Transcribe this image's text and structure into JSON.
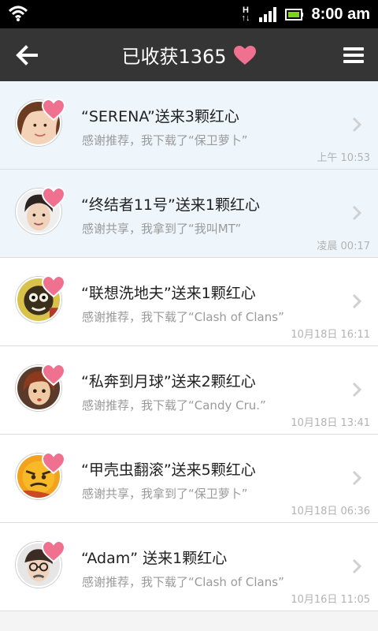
{
  "status_bar": {
    "time": "8:00 am",
    "network": "H"
  },
  "header": {
    "title": "已收获1365"
  },
  "items": [
    {
      "title": "“SERENA”送来3颗红心",
      "subtitle": "感谢推荐，我下载了“保卫萝卜”",
      "time": "上午 10:53",
      "unread": true,
      "avatar": "avatar-girl"
    },
    {
      "title": "“终结者11号”送来1颗红心",
      "subtitle": "感谢共享，我拿到了“我叫MT”",
      "time": "凌晨 00:17",
      "unread": true,
      "avatar": "avatar-boy"
    },
    {
      "title": "“联想洗地夫”送来1颗红心",
      "subtitle": "感谢推荐，我下载了“Clash of Clans”",
      "time": "10月18日 16:11",
      "unread": false,
      "avatar": "avatar-cartoon"
    },
    {
      "title": "“私奔到月球”送来2颗红心",
      "subtitle": "感谢推荐，我下载了“Candy Cru.”",
      "time": "10月18日 13:41",
      "unread": false,
      "avatar": "avatar-painted"
    },
    {
      "title": "“甲壳虫翻滚”送来5颗红心",
      "subtitle": "感谢共享，我拿到了“保卫萝卜”",
      "time": "10月18日 06:36",
      "unread": false,
      "avatar": "avatar-orange"
    },
    {
      "title": "“Adam” 送来1颗红心",
      "subtitle": "感谢推荐，我下载了“Clash of Clans”",
      "time": "10月16日 11:05",
      "unread": false,
      "avatar": "avatar-glasses"
    }
  ],
  "colors": {
    "header_bg": "#353535",
    "heart": "#f0708f",
    "unread_bg": "#eef6fc"
  }
}
